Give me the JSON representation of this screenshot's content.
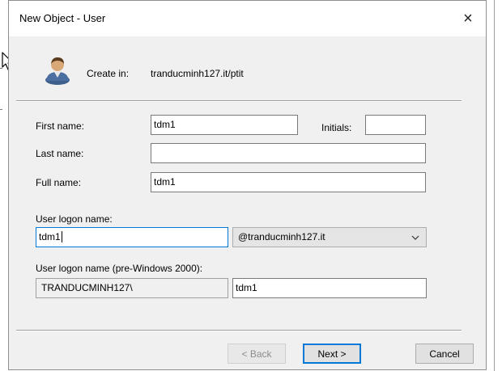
{
  "dialog": {
    "title": "New Object - User",
    "close_symbol": "×"
  },
  "header": {
    "create_in_label": "Create in:",
    "create_in_value": "tranducminh127.it/ptit",
    "icon": "user-icon"
  },
  "form": {
    "first_name_label": "First name:",
    "first_name_value": "tdm1",
    "initials_label": "Initials:",
    "initials_value": "",
    "last_name_label": "Last name:",
    "last_name_value": "",
    "full_name_label": "Full name:",
    "full_name_value": "tdm1",
    "logon_name_label": "User logon name:",
    "logon_name_value": "tdm1",
    "domain_value": "@tranducminh127.it",
    "pre2000_label": "User logon name (pre-Windows 2000):",
    "pre2000_domain": "TRANDUCMINH127\\",
    "pre2000_value": "tdm1"
  },
  "buttons": {
    "back": "< Back",
    "next": "Next >",
    "cancel": "Cancel"
  }
}
